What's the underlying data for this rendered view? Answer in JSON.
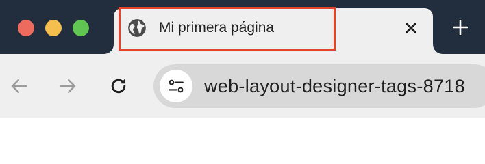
{
  "window": {
    "traffic_lights": {
      "close_color": "#ed6a5e",
      "minimize_color": "#f5bf4f",
      "maximize_color": "#61c554"
    },
    "titlebar_color": "#222d3d"
  },
  "tab": {
    "title": "Mi primera página",
    "icon": "globe-icon",
    "close_icon": "close-icon",
    "highlight_color": "#e5432c"
  },
  "new_tab": {
    "icon": "plus-icon"
  },
  "toolbar": {
    "back_icon": "arrow-left-icon",
    "forward_icon": "arrow-right-icon",
    "reload_icon": "reload-icon",
    "site_settings_icon": "tune-icon"
  },
  "address_bar": {
    "url": "web-layout-designer-tags-8718"
  }
}
